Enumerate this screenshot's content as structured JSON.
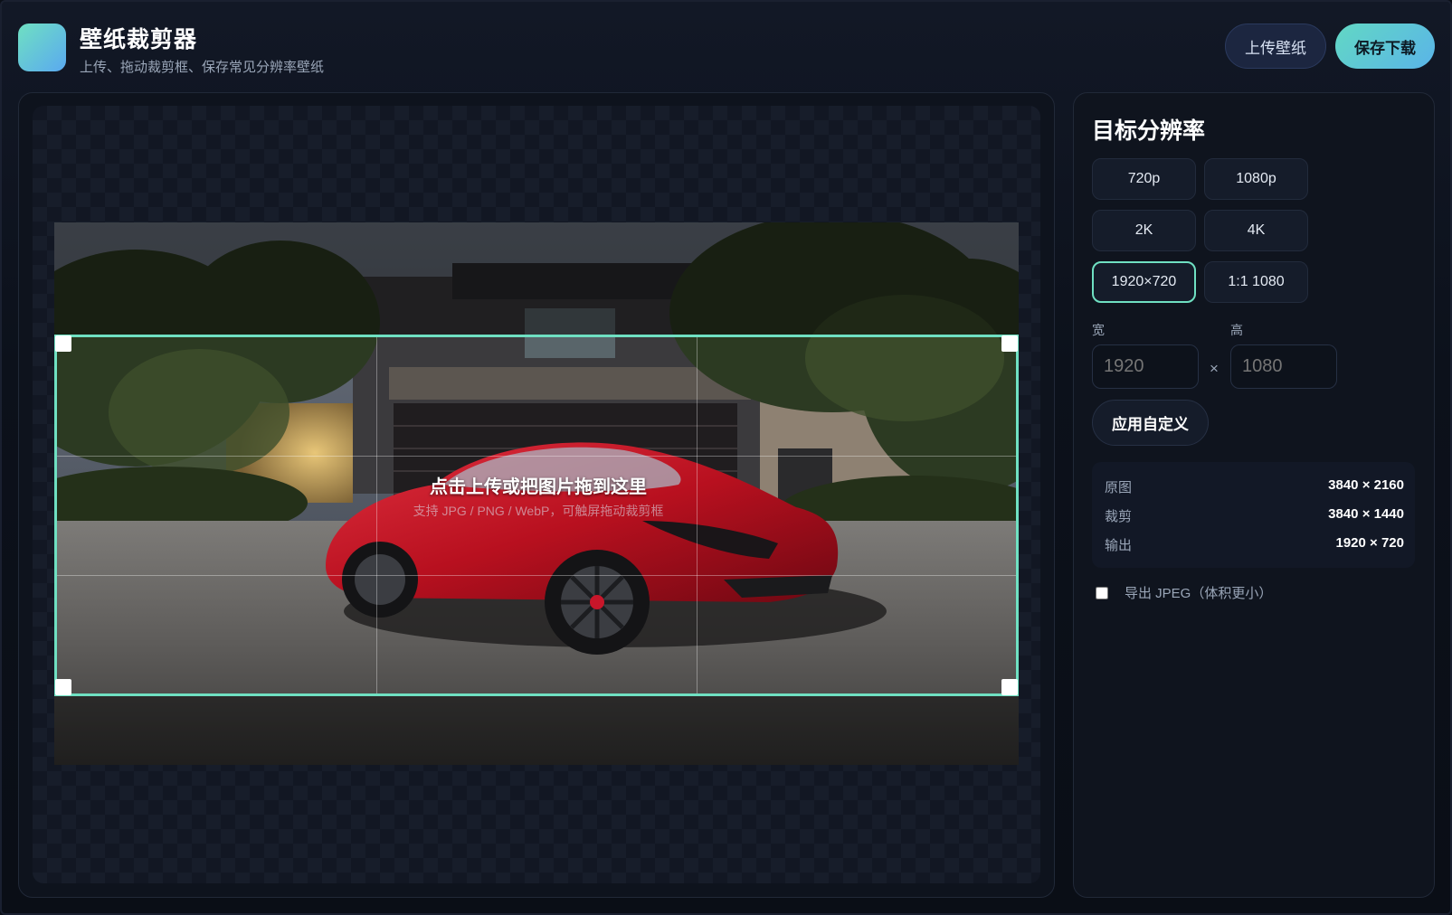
{
  "header": {
    "title": "壁纸裁剪器",
    "subtitle": "上传、拖动裁剪框、保存常见分辨率壁纸",
    "upload_label": "上传壁纸",
    "save_label": "保存下载"
  },
  "canvas": {
    "hint_title": "点击上传或把图片拖到这里",
    "hint_sub": "支持 JPG / PNG / WebP，可触屏拖动裁剪框"
  },
  "side": {
    "title": "目标分辨率",
    "presets": [
      "720p",
      "1080p",
      "2K",
      "4K",
      "1920×720",
      "1:1 1080"
    ],
    "active_preset": "1920×720",
    "width_label": "宽",
    "height_label": "高",
    "width_placeholder": "1920",
    "height_placeholder": "1080",
    "times": "×",
    "apply_label": "应用自定义",
    "info": [
      {
        "label": "原图",
        "value": "3840 × 2160"
      },
      {
        "label": "裁剪",
        "value": "3840 × 1440"
      },
      {
        "label": "输出",
        "value": "1920 × 720"
      }
    ],
    "jpeg_label": "导出 JPEG（体积更小）",
    "jpeg_checked": false
  },
  "colors": {
    "accent": "#6fe0c2",
    "background": "#0b0f17",
    "car": "#c8162a"
  }
}
